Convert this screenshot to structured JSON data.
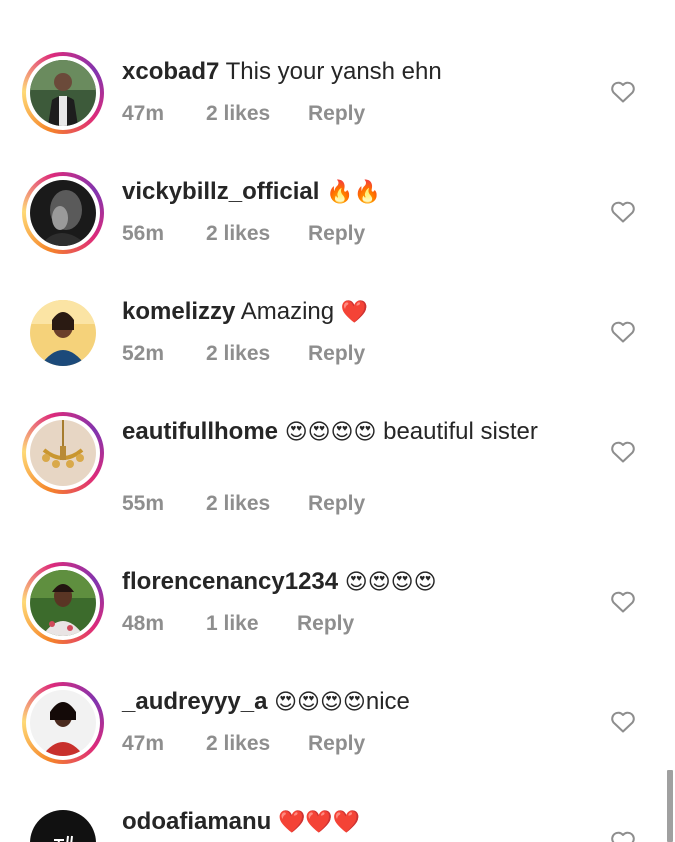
{
  "comments": [
    {
      "user": "xcobad7",
      "text": "This your yansh ehn",
      "emojis": "",
      "time": "47m",
      "likes": "2 likes",
      "reply": "Reply"
    },
    {
      "user": "vickybillz_official",
      "text": "",
      "emojis": "🔥🔥",
      "time": "56m",
      "likes": "2 likes",
      "reply": "Reply"
    },
    {
      "user": "komelizzy",
      "text": "Amazing",
      "emojis": "❤️",
      "time": "52m",
      "likes": "2 likes",
      "reply": "Reply"
    },
    {
      "user": "eautifullhome",
      "text": "beautiful",
      "emojis": "😍😍😍😍",
      "text2": "sister",
      "time": "55m",
      "likes": "2 likes",
      "reply": "Reply"
    },
    {
      "user": "florencenancy1234",
      "text": "",
      "emojis": "😍😍😍😍",
      "time": "48m",
      "likes": "1 like",
      "reply": "Reply"
    },
    {
      "user": "_audreyyy_a",
      "text": "nice",
      "emojis": "😍😍😍😍",
      "time": "47m",
      "likes": "2 likes",
      "reply": "Reply"
    },
    {
      "user": "odoafiamanu",
      "text": "",
      "emojis": "❤️❤️❤️",
      "time": "",
      "likes": "",
      "reply": ""
    }
  ],
  "icons": {
    "like": "heart-outline-icon"
  },
  "colors": {
    "text": "#262626",
    "meta": "#8e8e8e",
    "heart_red": "#ed4956"
  }
}
